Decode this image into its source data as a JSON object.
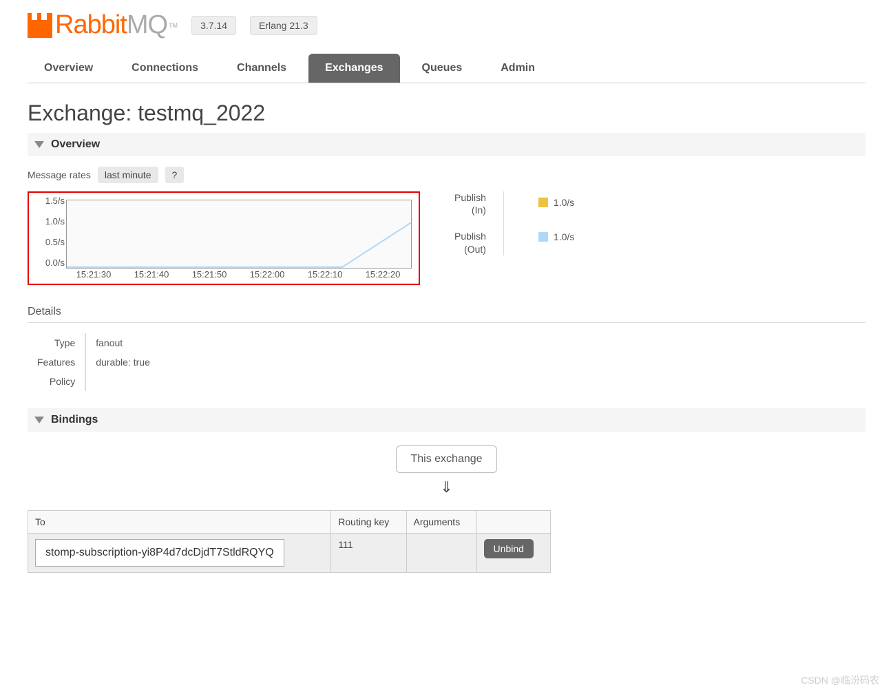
{
  "header": {
    "logo_main": "Rabbit",
    "logo_suffix": "MQ",
    "tm": "TM",
    "version": "3.7.14",
    "erlang": "Erlang 21.3"
  },
  "tabs": [
    "Overview",
    "Connections",
    "Channels",
    "Exchanges",
    "Queues",
    "Admin"
  ],
  "active_tab": "Exchanges",
  "page_title": "Exchange: testmq_2022",
  "sections": {
    "overview": "Overview",
    "bindings": "Bindings"
  },
  "rates": {
    "label": "Message rates",
    "period": "last minute",
    "help": "?"
  },
  "chart_data": {
    "type": "line",
    "ylabels": [
      "1.5/s",
      "1.0/s",
      "0.5/s",
      "0.0/s"
    ],
    "xlabels": [
      "15:21:30",
      "15:21:40",
      "15:21:50",
      "15:22:00",
      "15:22:10",
      "15:22:20"
    ],
    "ylim": [
      0,
      1.5
    ],
    "series": [
      {
        "name": "Publish (In)",
        "color": "#edc240",
        "latest": "1.0/s",
        "values": [
          0,
          0,
          0,
          0,
          0,
          1.0
        ]
      },
      {
        "name": "Publish (Out)",
        "color": "#afd8f8",
        "latest": "1.0/s",
        "values": [
          0,
          0,
          0,
          0,
          0,
          1.0
        ]
      }
    ]
  },
  "legend": {
    "in_label1": "Publish",
    "in_label2": "(In)",
    "in_value": "1.0/s",
    "out_label1": "Publish",
    "out_label2": "(Out)",
    "out_value": "1.0/s"
  },
  "details": {
    "title": "Details",
    "rows": {
      "type_label": "Type",
      "type_value": "fanout",
      "features_label": "Features",
      "features_value": "durable: true",
      "policy_label": "Policy",
      "policy_value": ""
    }
  },
  "bindings": {
    "node_label": "This exchange",
    "arrow": "⇓",
    "cols": {
      "to": "To",
      "rk": "Routing key",
      "args": "Arguments",
      "action": ""
    },
    "row": {
      "to": "stomp-subscription-yi8P4d7dcDjdT7StldRQYQ",
      "rk": "111",
      "args": "",
      "unbind": "Unbind"
    }
  },
  "watermark": "CSDN @临汾码农"
}
